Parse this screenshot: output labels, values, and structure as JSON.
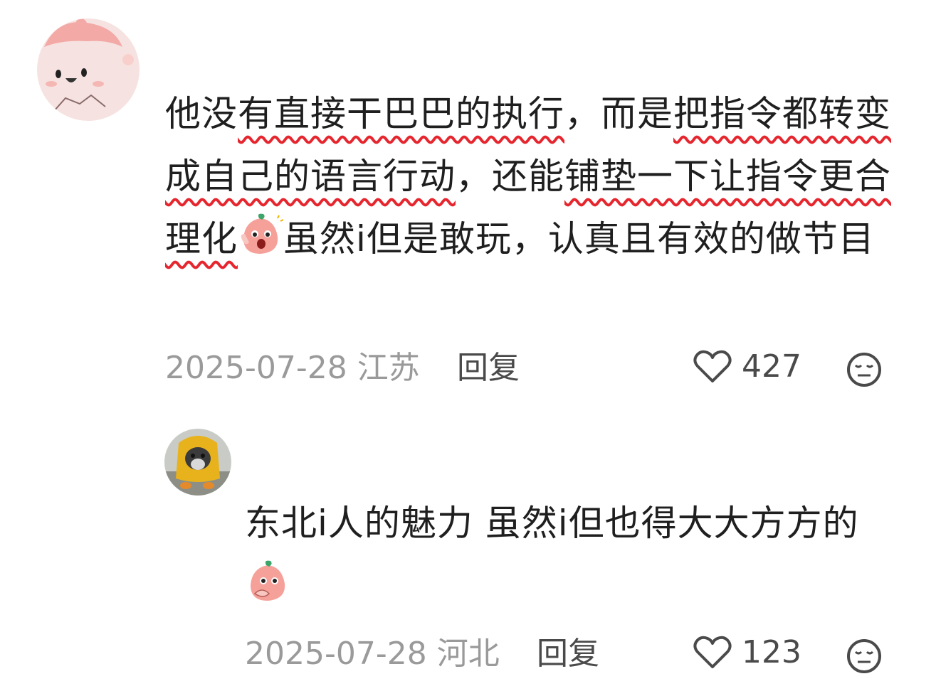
{
  "comments": [
    {
      "text": {
        "p1": "他没",
        "u1": "有直接干巴巴的执行",
        "p2": "，而是",
        "u2": "把指令都转变成自己的语言行动",
        "p3": "，还能",
        "u3": "铺垫一下让指令更合理化",
        "p4": "虽然i但是敢玩，认真且有效的做节目"
      },
      "date": "2025-07-28",
      "location": "江苏",
      "reply_label": "回复",
      "likes": "427",
      "emoji": "shocked-peach-emoji"
    },
    {
      "text": {
        "p1": "东北i人的魅力 虽然i但也得大大方方的"
      },
      "date": "2025-07-28",
      "location": "河北",
      "reply_label": "回复",
      "likes": "123",
      "emoji": "shy-peach-emoji"
    }
  ],
  "colors": {
    "underline": "#e6262e",
    "meta_text": "#9a9a9a",
    "action_text": "#4a4a4a"
  }
}
